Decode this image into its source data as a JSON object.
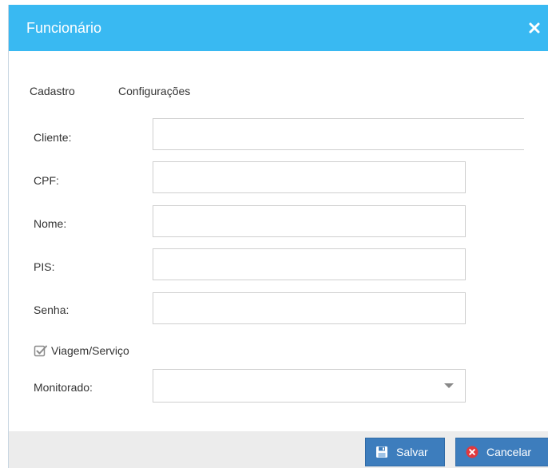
{
  "dialog": {
    "title": "Funcionário"
  },
  "tabs": [
    {
      "label": "Cadastro"
    },
    {
      "label": "Configurações"
    }
  ],
  "form": {
    "cliente": {
      "label": "Cliente:",
      "value": "",
      "placeholder": ""
    },
    "cpf": {
      "label": "CPF:",
      "value": "",
      "placeholder": ""
    },
    "nome": {
      "label": "Nome:",
      "value": "",
      "placeholder": ""
    },
    "pis": {
      "label": "PIS:",
      "value": "",
      "placeholder": ""
    },
    "senha": {
      "label": "Senha:",
      "value": "",
      "placeholder": ""
    },
    "viagem_servico": {
      "label": "Viagem/Serviço",
      "checked": true
    },
    "monitorado": {
      "label": "Monitorado:",
      "selected": ""
    }
  },
  "footer": {
    "save_label": "Salvar",
    "cancel_label": "Cancelar"
  },
  "colors": {
    "titlebar": "#39b9f2",
    "button": "#3d7dbd",
    "footer": "#ececec",
    "cancel_icon": "#e0393e"
  },
  "icons": {
    "close": "close-icon",
    "save": "floppy-disk-icon",
    "cancel": "x-circle-icon",
    "checkbox": "checkbox-checked-icon",
    "dropdown": "chevron-down-icon"
  }
}
